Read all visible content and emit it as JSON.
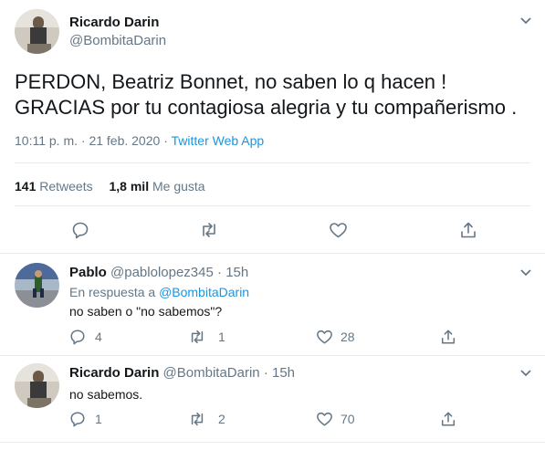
{
  "main_tweet": {
    "author_name": "Ricardo Darin",
    "author_handle": "@BombitaDarin",
    "text_line1": "PERDON, Beatriz Bonnet, no saben lo q hacen !",
    "text_line2": "GRACIAS por tu contagiosa alegria y tu compañerismo .",
    "timestamp": "10:11 p. m. · 21 feb. 2020",
    "separator": "·",
    "source": "Twitter Web App",
    "retweet_count": "141",
    "retweet_label": "Retweets",
    "like_count": "1,8 mil",
    "like_label": "Me gusta"
  },
  "replies": [
    {
      "author_name": "Pablo",
      "author_handle": "@pablolopez345",
      "dot": "·",
      "time": "15h",
      "reply_to_prefix": "En respuesta a",
      "reply_to_handle": "@BombitaDarin",
      "text": "no saben o \"no sabemos\"?",
      "reply_count": "4",
      "retweet_count": "1",
      "like_count": "28"
    },
    {
      "author_name": "Ricardo Darin",
      "author_handle": "@BombitaDarin",
      "dot": "·",
      "time": "15h",
      "text": "no sabemos.",
      "reply_count": "1",
      "retweet_count": "2",
      "like_count": "70"
    }
  ],
  "icons": {
    "reply": "reply-icon",
    "retweet": "retweet-icon",
    "like": "heart-icon",
    "share": "share-icon",
    "more": "chevron-down-icon"
  },
  "colors": {
    "link": "#1b95e0",
    "secondary_text": "#657786",
    "divider": "#e6ecf0"
  }
}
